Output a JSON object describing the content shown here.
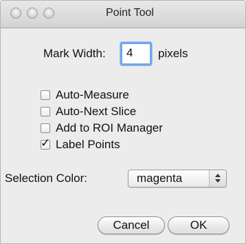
{
  "window": {
    "title": "Point Tool"
  },
  "mark_width": {
    "label": "Mark Width:",
    "value": "4",
    "unit": "pixels"
  },
  "options": [
    {
      "label": "Auto-Measure",
      "checked": false
    },
    {
      "label": "Auto-Next Slice",
      "checked": false
    },
    {
      "label": "Add to ROI Manager",
      "checked": false
    },
    {
      "label": "Label Points",
      "checked": true
    }
  ],
  "checkmark_glyph": "✓",
  "selection_color": {
    "label": "Selection Color:",
    "value": "magenta"
  },
  "buttons": {
    "cancel": "Cancel",
    "ok": "OK"
  }
}
